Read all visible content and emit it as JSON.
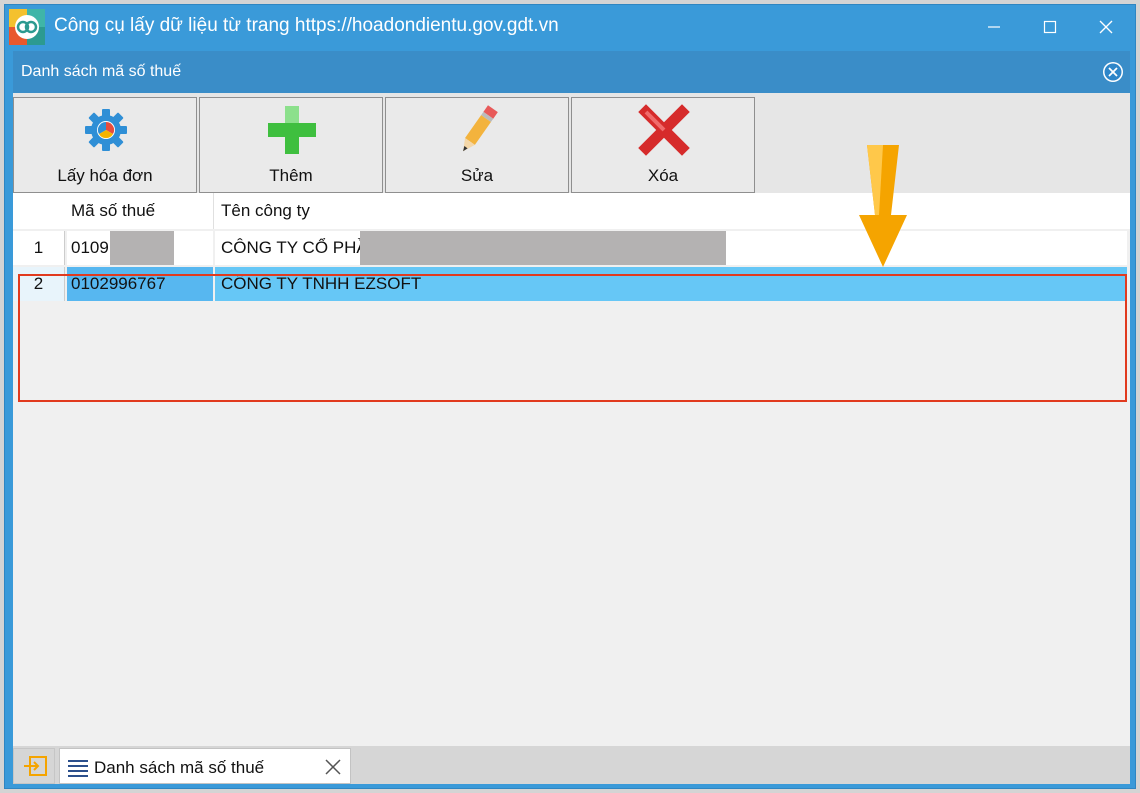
{
  "window": {
    "title": "Công cụ lấy dữ liệu từ trang https://hoadondientu.gov.gdt.vn",
    "minimize_icon": "minimize-icon",
    "maximize_icon": "maximize-icon",
    "close_icon": "close-icon"
  },
  "panel": {
    "title": "Danh sách mã số thuế",
    "close_icon": "circle-close-icon"
  },
  "toolbar": {
    "buttons": [
      {
        "label": "Lấy hóa đơn",
        "icon": "gear-icon"
      },
      {
        "label": "Thêm",
        "icon": "plus-icon"
      },
      {
        "label": "Sửa",
        "icon": "pencil-icon"
      },
      {
        "label": "Xóa",
        "icon": "x-delete-icon"
      }
    ]
  },
  "grid": {
    "columns": [
      "Mã số thuế",
      "Tên công ty"
    ],
    "rows": [
      {
        "num": "1",
        "tax_code": "0109",
        "company": "CÔNG TY CỔ PHẦ",
        "redacted": true
      },
      {
        "num": "2",
        "tax_code": "0102996767",
        "company": "CÔNG TY TNHH EZSOFT",
        "selected": true
      }
    ]
  },
  "statusbar": {
    "tab_label": "Danh sách mã số thuế",
    "tab_icon": "list-icon",
    "left_icon": "enter-icon",
    "tab_close_icon": "close-icon"
  },
  "colors": {
    "titlebar": "#3a9ad9",
    "panel_header": "#3a8dc8",
    "selected_row": "#66c7f6",
    "highlight_box": "#e13a1e",
    "arrow": "#f5a400"
  }
}
